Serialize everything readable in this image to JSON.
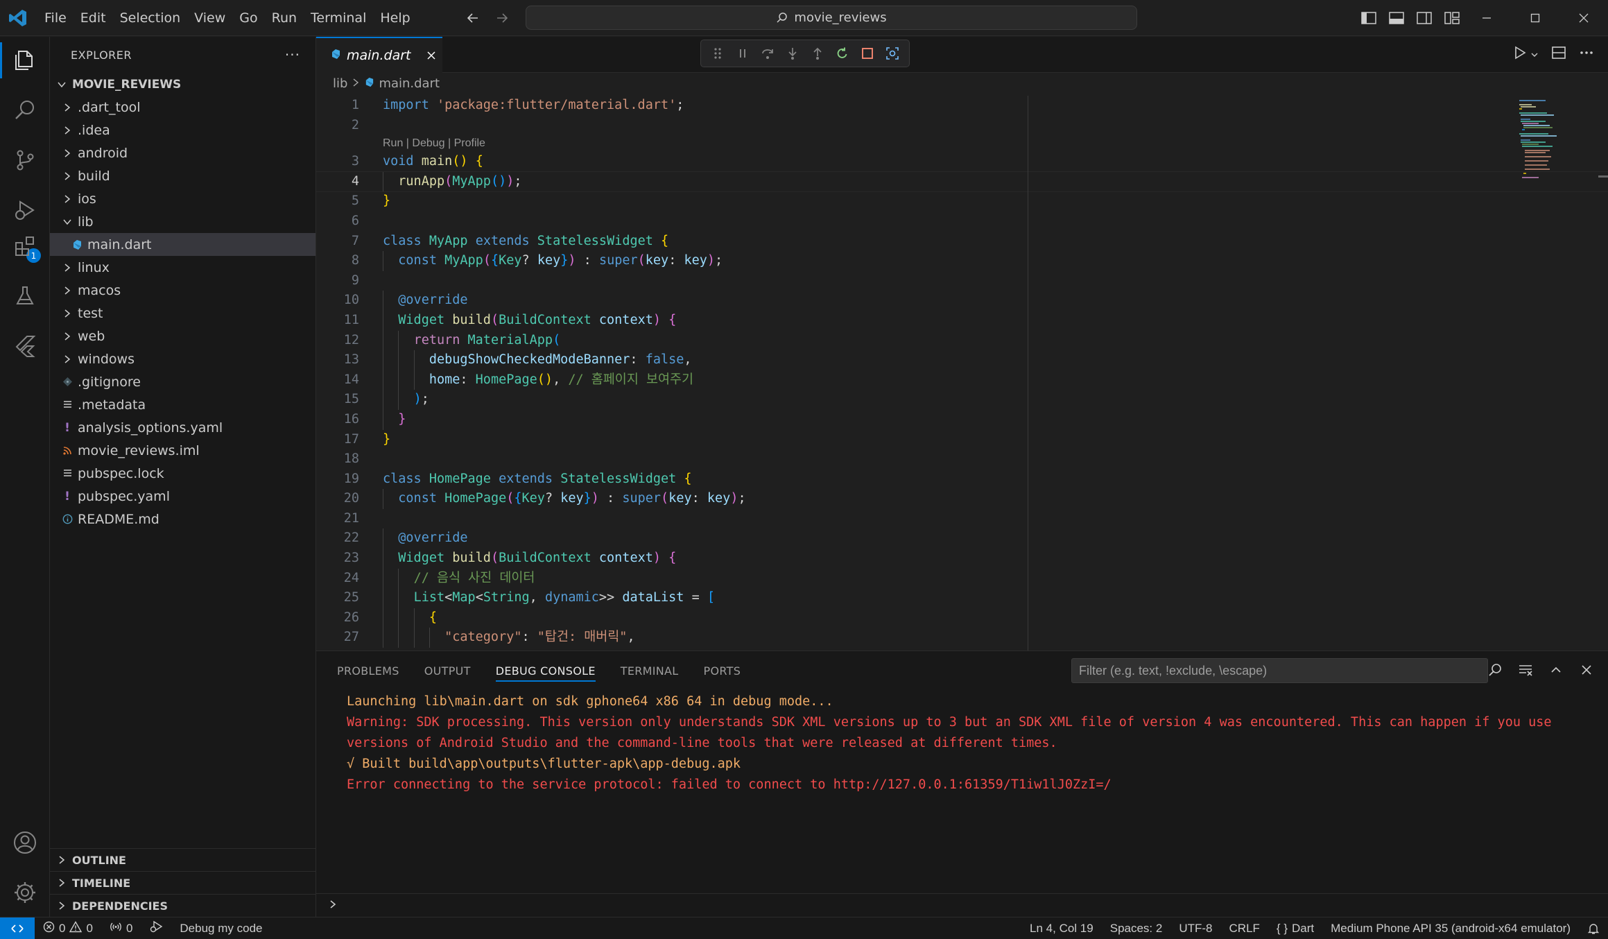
{
  "titlebar": {
    "menu": [
      "File",
      "Edit",
      "Selection",
      "View",
      "Go",
      "Run",
      "Terminal",
      "Help"
    ],
    "search_text": "movie_reviews"
  },
  "activity": {
    "debug_badge": "1"
  },
  "sidebar": {
    "title": "EXPLORER",
    "more": "···",
    "folder": "MOVIE_REVIEWS",
    "tree": [
      {
        "label": ".dart_tool",
        "type": "folder",
        "depth": 1
      },
      {
        "label": ".idea",
        "type": "folder",
        "depth": 1
      },
      {
        "label": "android",
        "type": "folder",
        "depth": 1
      },
      {
        "label": "build",
        "type": "folder",
        "depth": 1
      },
      {
        "label": "ios",
        "type": "folder",
        "depth": 1
      },
      {
        "label": "lib",
        "type": "folder-open",
        "depth": 1
      },
      {
        "label": "main.dart",
        "type": "dart",
        "depth": 2,
        "selected": true
      },
      {
        "label": "linux",
        "type": "folder",
        "depth": 1
      },
      {
        "label": "macos",
        "type": "folder",
        "depth": 1
      },
      {
        "label": "test",
        "type": "folder",
        "depth": 1
      },
      {
        "label": "web",
        "type": "folder",
        "depth": 1
      },
      {
        "label": "windows",
        "type": "folder",
        "depth": 1
      },
      {
        "label": ".gitignore",
        "type": "git",
        "depth": 1
      },
      {
        "label": ".metadata",
        "type": "lines",
        "depth": 1
      },
      {
        "label": "analysis_options.yaml",
        "type": "yaml",
        "depth": 1
      },
      {
        "label": "movie_reviews.iml",
        "type": "rss",
        "depth": 1
      },
      {
        "label": "pubspec.lock",
        "type": "lines",
        "depth": 1
      },
      {
        "label": "pubspec.yaml",
        "type": "yaml",
        "depth": 1
      },
      {
        "label": "README.md",
        "type": "info",
        "depth": 1
      }
    ],
    "sections": [
      "OUTLINE",
      "TIMELINE",
      "DEPENDENCIES"
    ]
  },
  "editor": {
    "tab_label": "main.dart",
    "breadcrumb": [
      "lib",
      "main.dart"
    ],
    "codelens": "Run | Debug | Profile",
    "lines": [
      {
        "n": "1",
        "tokens": [
          [
            "kw",
            "import"
          ],
          [
            "plain",
            " "
          ],
          [
            "str",
            "'package:flutter/material.dart'"
          ],
          [
            "plain",
            ";"
          ]
        ]
      },
      {
        "n": "2",
        "tokens": []
      },
      {
        "n": "3",
        "lens": true,
        "tokens": [
          [
            "kw",
            "void"
          ],
          [
            "plain",
            " "
          ],
          [
            "fn",
            "main"
          ],
          [
            "br1",
            "()"
          ],
          [
            "plain",
            " "
          ],
          [
            "br1",
            "{"
          ]
        ]
      },
      {
        "n": "4",
        "current": true,
        "indent": 1,
        "tokens": [
          [
            "fn",
            "runApp"
          ],
          [
            "br2",
            "("
          ],
          [
            "cls",
            "MyApp"
          ],
          [
            "br3",
            "()"
          ],
          [
            "br2",
            ")"
          ],
          [
            "plain",
            ";"
          ]
        ]
      },
      {
        "n": "5",
        "tokens": [
          [
            "br1",
            "}"
          ]
        ]
      },
      {
        "n": "6",
        "tokens": []
      },
      {
        "n": "7",
        "tokens": [
          [
            "kw",
            "class"
          ],
          [
            "plain",
            " "
          ],
          [
            "cls",
            "MyApp"
          ],
          [
            "plain",
            " "
          ],
          [
            "kw",
            "extends"
          ],
          [
            "plain",
            " "
          ],
          [
            "cls",
            "StatelessWidget"
          ],
          [
            "plain",
            " "
          ],
          [
            "br1",
            "{"
          ]
        ]
      },
      {
        "n": "8",
        "indent": 1,
        "tokens": [
          [
            "kw",
            "const"
          ],
          [
            "plain",
            " "
          ],
          [
            "cls",
            "MyApp"
          ],
          [
            "br2",
            "("
          ],
          [
            "br3",
            "{"
          ],
          [
            "cls",
            "Key"
          ],
          [
            "plain",
            "? "
          ],
          [
            "var",
            "key"
          ],
          [
            "br3",
            "}"
          ],
          [
            "br2",
            ")"
          ],
          [
            "plain",
            " : "
          ],
          [
            "kw",
            "super"
          ],
          [
            "br2",
            "("
          ],
          [
            "var",
            "key"
          ],
          [
            "plain",
            ": "
          ],
          [
            "var",
            "key"
          ],
          [
            "br2",
            ")"
          ],
          [
            "plain",
            ";"
          ]
        ]
      },
      {
        "n": "9",
        "tokens": []
      },
      {
        "n": "10",
        "indent": 1,
        "tokens": [
          [
            "kw",
            "@override"
          ]
        ]
      },
      {
        "n": "11",
        "indent": 1,
        "tokens": [
          [
            "cls",
            "Widget"
          ],
          [
            "plain",
            " "
          ],
          [
            "fn",
            "build"
          ],
          [
            "br2",
            "("
          ],
          [
            "cls",
            "BuildContext"
          ],
          [
            "plain",
            " "
          ],
          [
            "var",
            "context"
          ],
          [
            "br2",
            ")"
          ],
          [
            "plain",
            " "
          ],
          [
            "br2",
            "{"
          ]
        ]
      },
      {
        "n": "12",
        "indent": 2,
        "tokens": [
          [
            "ctl",
            "return"
          ],
          [
            "plain",
            " "
          ],
          [
            "cls",
            "MaterialApp"
          ],
          [
            "br3",
            "("
          ]
        ]
      },
      {
        "n": "13",
        "indent": 3,
        "tokens": [
          [
            "var",
            "debugShowCheckedModeBanner"
          ],
          [
            "plain",
            ": "
          ],
          [
            "kw",
            "false"
          ],
          [
            "plain",
            ","
          ]
        ]
      },
      {
        "n": "14",
        "indent": 3,
        "tokens": [
          [
            "var",
            "home"
          ],
          [
            "plain",
            ": "
          ],
          [
            "cls",
            "HomePage"
          ],
          [
            "br1",
            "()"
          ],
          [
            "plain",
            ", "
          ],
          [
            "com",
            "// 홈페이지 보여주기"
          ]
        ]
      },
      {
        "n": "15",
        "indent": 2,
        "tokens": [
          [
            "br3",
            ")"
          ],
          [
            "plain",
            ";"
          ]
        ]
      },
      {
        "n": "16",
        "indent": 1,
        "tokens": [
          [
            "br2",
            "}"
          ]
        ]
      },
      {
        "n": "17",
        "tokens": [
          [
            "br1",
            "}"
          ]
        ]
      },
      {
        "n": "18",
        "tokens": []
      },
      {
        "n": "19",
        "tokens": [
          [
            "kw",
            "class"
          ],
          [
            "plain",
            " "
          ],
          [
            "cls",
            "HomePage"
          ],
          [
            "plain",
            " "
          ],
          [
            "kw",
            "extends"
          ],
          [
            "plain",
            " "
          ],
          [
            "cls",
            "StatelessWidget"
          ],
          [
            "plain",
            " "
          ],
          [
            "br1",
            "{"
          ]
        ]
      },
      {
        "n": "20",
        "indent": 1,
        "tokens": [
          [
            "kw",
            "const"
          ],
          [
            "plain",
            " "
          ],
          [
            "cls",
            "HomePage"
          ],
          [
            "br2",
            "("
          ],
          [
            "br3",
            "{"
          ],
          [
            "cls",
            "Key"
          ],
          [
            "plain",
            "? "
          ],
          [
            "var",
            "key"
          ],
          [
            "br3",
            "}"
          ],
          [
            "br2",
            ")"
          ],
          [
            "plain",
            " : "
          ],
          [
            "kw",
            "super"
          ],
          [
            "br2",
            "("
          ],
          [
            "var",
            "key"
          ],
          [
            "plain",
            ": "
          ],
          [
            "var",
            "key"
          ],
          [
            "br2",
            ")"
          ],
          [
            "plain",
            ";"
          ]
        ]
      },
      {
        "n": "21",
        "tokens": []
      },
      {
        "n": "22",
        "indent": 1,
        "tokens": [
          [
            "kw",
            "@override"
          ]
        ]
      },
      {
        "n": "23",
        "indent": 1,
        "tokens": [
          [
            "cls",
            "Widget"
          ],
          [
            "plain",
            " "
          ],
          [
            "fn",
            "build"
          ],
          [
            "br2",
            "("
          ],
          [
            "cls",
            "BuildContext"
          ],
          [
            "plain",
            " "
          ],
          [
            "var",
            "context"
          ],
          [
            "br2",
            ")"
          ],
          [
            "plain",
            " "
          ],
          [
            "br2",
            "{"
          ]
        ]
      },
      {
        "n": "24",
        "indent": 2,
        "tokens": [
          [
            "com",
            "// 음식 사진 데이터"
          ]
        ]
      },
      {
        "n": "25",
        "indent": 2,
        "tokens": [
          [
            "cls",
            "List"
          ],
          [
            "plain",
            "<"
          ],
          [
            "cls",
            "Map"
          ],
          [
            "plain",
            "<"
          ],
          [
            "cls",
            "String"
          ],
          [
            "plain",
            ", "
          ],
          [
            "kw",
            "dynamic"
          ],
          [
            "plain",
            ">> "
          ],
          [
            "var",
            "dataList"
          ],
          [
            "plain",
            " = "
          ],
          [
            "br3",
            "["
          ]
        ]
      },
      {
        "n": "26",
        "indent": 3,
        "tokens": [
          [
            "br1",
            "{"
          ]
        ]
      },
      {
        "n": "27",
        "indent": 4,
        "tokens": [
          [
            "str",
            "\"category\""
          ],
          [
            "plain",
            ": "
          ],
          [
            "str",
            "\"탑건: 매버릭\""
          ],
          [
            "plain",
            ","
          ]
        ]
      }
    ]
  },
  "panel": {
    "tabs": [
      "PROBLEMS",
      "OUTPUT",
      "DEBUG CONSOLE",
      "TERMINAL",
      "PORTS"
    ],
    "active_tab": 2,
    "filter_placeholder": "Filter (e.g. text, !exclude, \\escape)",
    "console": [
      {
        "kind": "warn",
        "text": "Launching lib\\main.dart on sdk gphone64 x86 64 in debug mode..."
      },
      {
        "kind": "err",
        "text": "Warning: SDK processing. This version only understands SDK XML versions up to 3 but an SDK XML file of version 4 was encountered. This can happen if you use versions of Android Studio and the command-line tools that were released at different times."
      },
      {
        "kind": "warn",
        "text": "√ Built build\\app\\outputs\\flutter-apk\\app-debug.apk"
      },
      {
        "kind": "err",
        "text": "Error connecting to the service protocol: failed to connect to http://127.0.0.1:61359/T1iw1lJ0ZzI=/"
      }
    ]
  },
  "statusbar": {
    "errors": "0",
    "warnings": "0",
    "ports": "0",
    "debug_label": "Debug my code",
    "position": "Ln 4, Col 19",
    "spaces": "Spaces: 2",
    "encoding": "UTF-8",
    "eol": "CRLF",
    "language": "Dart",
    "device": "Medium Phone API 35 (android-x64 emulator)"
  },
  "colors": {
    "accent": "#0078d4",
    "background": "#1f1f1f",
    "sidebar": "#181818"
  }
}
